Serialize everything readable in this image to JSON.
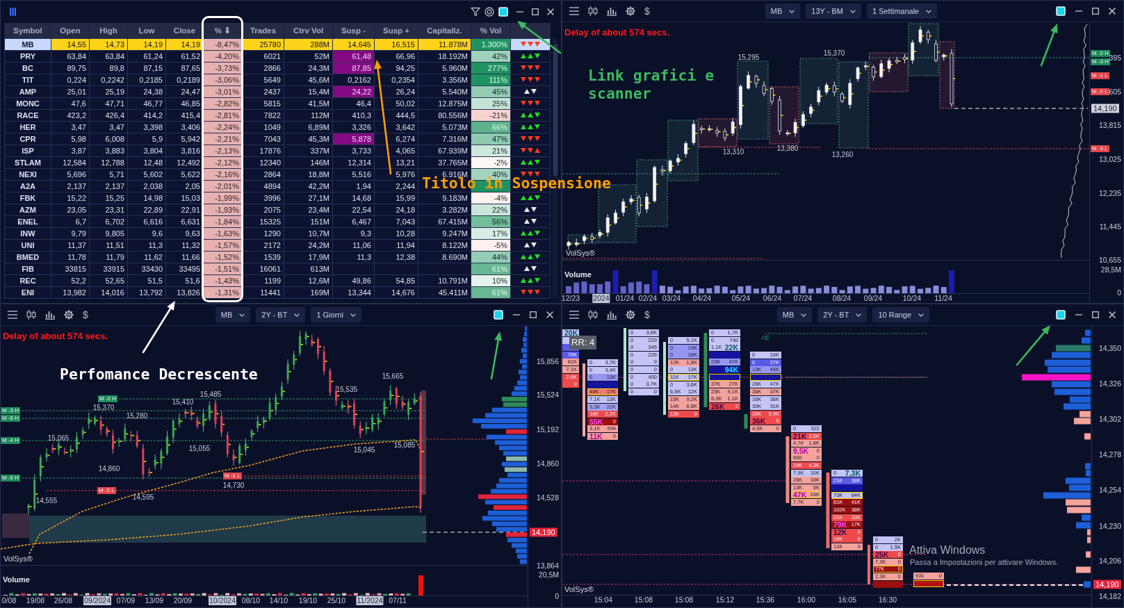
{
  "scanner": {
    "linked": true,
    "columns": [
      "Symbol",
      "Open",
      "High",
      "Low",
      "Close",
      "% ⬇",
      "Trades",
      "Ctrv Vol",
      "Susp -",
      "Susp +",
      "Capitaliz.",
      "% Vol"
    ],
    "rows": [
      {
        "selected": true,
        "cells": [
          "MB",
          "14,55",
          "14,73",
          "14,19",
          "14,19",
          "-8,47%",
          "25780",
          "288M",
          {
            "text": "14,645",
            "flagged": false
          },
          "16,515",
          "11.878M",
          {
            "text": "1.300%",
            "color": "#1f9462"
          }
        ],
        "trend": {
          "color": "#ff3b1a",
          "arrows": [
            {
              "kind": "down"
            },
            {
              "kind": "down"
            },
            {
              "kind": "down"
            }
          ]
        }
      },
      {
        "selected": false,
        "cells": [
          "PRY",
          "63,84",
          "63,84",
          "61,24",
          "61,52",
          "-4,20%",
          "6021",
          "52M",
          {
            "text": "61,48",
            "flagged": true
          },
          "66,96",
          "18.192M",
          {
            "text": "42%",
            "color": "#9ed2bb"
          }
        ],
        "trend": {
          "color": "#1ee01e",
          "arrows": [
            {
              "kind": "up"
            },
            {
              "kind": "up"
            },
            {
              "kind": "down"
            }
          ]
        }
      },
      {
        "selected": false,
        "cells": [
          "BC",
          "89,75",
          "89,8",
          "87,15",
          "87,65",
          "-3,73%",
          "2866",
          "24,3M",
          {
            "text": "87,85",
            "flagged": true
          },
          "94,25",
          "5.960M",
          {
            "text": "277%",
            "color": "#1f9462"
          }
        ],
        "trend": {
          "color": "#ff3b1a",
          "arrows": [
            {
              "kind": "down"
            },
            {
              "kind": "down"
            },
            {
              "kind": "down"
            }
          ]
        }
      },
      {
        "selected": false,
        "cells": [
          "TIT",
          "0,224",
          "0,2242",
          "0,2185",
          "0,2189",
          "-3,06%",
          "5649",
          "45,6M",
          {
            "text": "0,2162",
            "flagged": false
          },
          "0,2354",
          "3.356M",
          {
            "text": "111%",
            "color": "#1f9462"
          }
        ],
        "trend": {
          "color": "#ff3b1a",
          "arrows": [
            {
              "kind": "down"
            },
            {
              "kind": "down"
            },
            {
              "kind": "down"
            }
          ]
        }
      },
      {
        "selected": false,
        "cells": [
          "AMP",
          "25,01",
          "25,19",
          "24,38",
          "24,47",
          "-3,01%",
          "2437",
          "15,4M",
          {
            "text": "24,22",
            "flagged": true
          },
          "26,24",
          "5.540M",
          {
            "text": "45%",
            "color": "#93cdb4"
          }
        ],
        "trend": {
          "color": "#e6e9f2",
          "arrows": [
            {
              "kind": "up"
            },
            {
              "kind": "down"
            }
          ]
        }
      },
      {
        "selected": false,
        "cells": [
          "MONC",
          "47,6",
          "47,71",
          "46,77",
          "46,85",
          "-2,82%",
          "5815",
          "41,5M",
          {
            "text": "46,4",
            "flagged": false
          },
          "50,02",
          "12.875M",
          {
            "text": "25%",
            "color": "#c4e4d5"
          }
        ],
        "trend": {
          "color": "#ff3b1a",
          "arrows": [
            {
              "kind": "down"
            },
            {
              "kind": "down"
            },
            {
              "kind": "down"
            }
          ]
        }
      },
      {
        "selected": false,
        "cells": [
          "RACE",
          "423,2",
          "426,4",
          "414,2",
          "415,4",
          "-2,81%",
          "7822",
          "112M",
          {
            "text": "410,3",
            "flagged": false
          },
          "444,5",
          "80.556M",
          {
            "text": "-21%",
            "color": "#f7d3cf"
          }
        ],
        "trend": {
          "color": "#1ee01e",
          "arrows": [
            {
              "kind": "up"
            },
            {
              "kind": "up"
            },
            {
              "kind": "down"
            }
          ]
        }
      },
      {
        "selected": false,
        "cells": [
          "HER",
          "3,47",
          "3,47",
          "3,398",
          "3,406",
          "-2,24%",
          "1049",
          "6,89M",
          {
            "text": "3,326",
            "flagged": false
          },
          "3,642",
          "5.073M",
          {
            "text": "66%",
            "color": "#5db38c"
          }
        ],
        "trend": {
          "color": "#1ee01e",
          "arrows": [
            {
              "kind": "up"
            },
            {
              "kind": "up"
            },
            {
              "kind": "down"
            }
          ]
        }
      },
      {
        "selected": false,
        "cells": [
          "CPR",
          "5,98",
          "6,008",
          "5,9",
          "5,942",
          "-2,21%",
          "7043",
          "45,3M",
          {
            "text": "5,878",
            "flagged": true
          },
          "6,274",
          "7.316M",
          {
            "text": "47%",
            "color": "#8dcaaf"
          }
        ],
        "trend": {
          "color": "#ff3b1a",
          "arrows": [
            {
              "kind": "down"
            },
            {
              "kind": "down"
            },
            {
              "kind": "down"
            }
          ]
        }
      },
      {
        "selected": false,
        "cells": [
          "ISP",
          "3,87",
          "3,883",
          "3,804",
          "3,816",
          "-2,13%",
          "17876",
          "337M",
          {
            "text": "3,733",
            "flagged": false
          },
          "4,065",
          "67.939M",
          {
            "text": "21%",
            "color": "#cde8db"
          }
        ],
        "trend": {
          "color": "#ff3b1a",
          "arrows": [
            {
              "kind": "down"
            },
            {
              "kind": "down"
            },
            {
              "kind": "up"
            }
          ]
        }
      },
      {
        "selected": false,
        "cells": [
          "STLAM",
          "12,584",
          "12,788",
          "12,48",
          "12,492",
          "-2,12%",
          "12340",
          "146M",
          {
            "text": "12,314",
            "flagged": false
          },
          "13,21",
          "37.765M",
          {
            "text": "-2%",
            "color": "#fdf7f5"
          }
        ],
        "trend": {
          "color": "#1ee01e",
          "arrows": [
            {
              "kind": "up"
            },
            {
              "kind": "up"
            },
            {
              "kind": "down"
            }
          ]
        }
      },
      {
        "selected": false,
        "cells": [
          "NEXI",
          "5,696",
          "5,71",
          "5,602",
          "5,622",
          "-2,16%",
          "2864",
          "18,8M",
          {
            "text": "5,516",
            "flagged": false
          },
          "5,976",
          "6.916M",
          {
            "text": "40%",
            "color": "#a3d4be"
          }
        ],
        "trend": {
          "color": "#ff3b1a",
          "arrows": [
            {
              "kind": "down"
            },
            {
              "kind": "down"
            },
            {
              "kind": "down"
            }
          ]
        }
      },
      {
        "selected": false,
        "cells": [
          "A2A",
          "2,137",
          "2,137",
          "2,038",
          "2,05",
          "-2,01%",
          "4894",
          "42,2M",
          {
            "text": "1,94",
            "flagged": false
          },
          "2,244",
          "",
          {
            "color": "#1f9462"
          }
        ]
      },
      {
        "selected": false,
        "cells": [
          "FBK",
          "15,22",
          "15,25",
          "14,98",
          "15,03",
          "-1,99%",
          "3996",
          "27,1M",
          {
            "text": "14,68",
            "flagged": false
          },
          "15,99",
          "9.183M",
          {
            "text": "-4%",
            "color": "#fdf2ef"
          }
        ],
        "trend": {
          "color": "#1ee01e",
          "arrows": [
            {
              "kind": "up"
            },
            {
              "kind": "up"
            },
            {
              "kind": "down"
            }
          ]
        }
      },
      {
        "selected": false,
        "cells": [
          "AZM",
          "23,05",
          "23,31",
          "22,89",
          "22,91",
          "-1,93%",
          "2075",
          "23,4M",
          {
            "text": "22,54",
            "flagged": false
          },
          "24,18",
          "3.282M",
          {
            "text": "22%",
            "color": "#cae6d9"
          }
        ],
        "trend": {
          "color": "#e6e9f2",
          "arrows": [
            {
              "kind": "up"
            },
            {
              "kind": "down"
            }
          ]
        }
      },
      {
        "selected": false,
        "cells": [
          "ENEL",
          "6,7",
          "6,702",
          "6,616",
          "6,631",
          "-1,84%",
          "15325",
          "151M",
          {
            "text": "6,467",
            "flagged": false
          },
          "7,043",
          "67.415M",
          {
            "text": "56%",
            "color": "#72bd9a"
          }
        ],
        "trend": {
          "color": "#e6e9f2",
          "arrows": [
            {
              "kind": "up"
            },
            {
              "kind": "down"
            }
          ]
        }
      },
      {
        "selected": false,
        "cells": [
          "INW",
          "9,79",
          "9,805",
          "9,6",
          "9,63",
          "-1,63%",
          "1290",
          "10,7M",
          {
            "text": "9,3",
            "flagged": false
          },
          "10,28",
          "9.247M",
          {
            "text": "17%",
            "color": "#d7ede3"
          }
        ],
        "trend": {
          "color": "#1ee01e",
          "arrows": [
            {
              "kind": "up"
            },
            {
              "kind": "up"
            },
            {
              "kind": "down"
            }
          ]
        }
      },
      {
        "selected": false,
        "cells": [
          "UNI",
          "11,37",
          "11,51",
          "11,3",
          "11,32",
          "-1,57%",
          "2172",
          "24,2M",
          {
            "text": "11,06",
            "flagged": false
          },
          "11,94",
          "8.122M",
          {
            "text": "-5%",
            "color": "#fdf0ed"
          }
        ],
        "trend": {
          "color": "#e6e9f2",
          "arrows": [
            {
              "kind": "up"
            },
            {
              "kind": "down"
            }
          ]
        }
      },
      {
        "selected": false,
        "cells": [
          "BMED",
          "11,78",
          "11,79",
          "11,62",
          "11,66",
          "-1,52%",
          "1539",
          "17,9M",
          {
            "text": "11,3",
            "flagged": false
          },
          "12,38",
          "8.690M",
          {
            "text": "44%",
            "color": "#96ceb5"
          }
        ],
        "trend": {
          "color": "#1ee01e",
          "arrows": [
            {
              "kind": "up"
            },
            {
              "kind": "up"
            },
            {
              "kind": "down"
            }
          ]
        }
      },
      {
        "selected": false,
        "cells": [
          "FIB",
          "33815",
          "33915",
          "33430",
          "33495",
          "-1,51%",
          "16061",
          "613M",
          "",
          "",
          "",
          {
            "text": "61%",
            "color": "#67b793"
          }
        ],
        "trend": {
          "color": "#e6e9f2",
          "arrows": [
            {
              "kind": "up"
            },
            {
              "kind": "down"
            }
          ]
        }
      },
      {
        "selected": false,
        "cells": [
          "REC",
          "52,2",
          "52,65",
          "51,5",
          "51,6",
          "-1,43%",
          "1199",
          "12,6M",
          {
            "text": "49,86",
            "flagged": false
          },
          "54,85",
          "10.791M",
          {
            "text": "10%",
            "color": "#e5f3ec"
          }
        ],
        "trend": {
          "color": "#1ee01e",
          "arrows": [
            {
              "kind": "up"
            },
            {
              "kind": "up"
            },
            {
              "kind": "down"
            }
          ]
        }
      },
      {
        "selected": false,
        "cells": [
          "ENI",
          "13,982",
          "14,016",
          "13,792",
          "13,826",
          "-1,31%",
          "11441",
          "169M",
          {
            "text": "13,344",
            "flagged": false
          },
          "14,676",
          "45.411M",
          {
            "text": "61%",
            "color": "#67b793"
          }
        ],
        "trend": {
          "color": "#ff3b1a",
          "arrows": [
            {
              "kind": "down"
            },
            {
              "kind": "down"
            },
            {
              "kind": "down"
            }
          ]
        }
      }
    ]
  },
  "charts": [
    {
      "kind": "box_candles",
      "toolbar": {
        "currency": "$",
        "selectors": [
          "MB",
          "13Y - BM",
          "1 Settimanale"
        ],
        "linked": true
      },
      "delay": "Delay of about 574 secs.",
      "price_labels": [
        "15,295",
        "15,370",
        "13,310",
        "13,380",
        "13,260"
      ],
      "brand": "VolSys®",
      "price_ticks": [
        "395",
        "605",
        "13,815",
        "13,025",
        "12,235",
        "11,445",
        "10,655"
      ],
      "price_tags": [
        {
          "text": "M -2 H",
          "kind": "high"
        },
        {
          "text": "M -3 H",
          "kind": "high"
        },
        {
          "text": "M -1 L",
          "kind": "low"
        },
        {
          "text": "M -2 L",
          "kind": "low"
        },
        {
          "text": "M -3 L",
          "kind": "low"
        }
      ],
      "last_price": {
        "text": "14,190",
        "kind": "neutral"
      },
      "volume": {
        "label": "Volume",
        "ticks": [
          "28,5M",
          "0"
        ]
      },
      "time_ticks": [
        {
          "text": "12/23",
          "highlighted": false
        },
        {
          "text": "2024",
          "highlighted": true
        },
        {
          "text": "01/24",
          "highlighted": false
        },
        {
          "text": "02/24",
          "highlighted": false
        },
        {
          "text": "03/24",
          "highlighted": false
        },
        {
          "text": "04/24",
          "highlighted": false
        },
        {
          "text": "05/24",
          "highlighted": false
        },
        {
          "text": "06/24",
          "highlighted": false
        },
        {
          "text": "07/24",
          "highlighted": false
        },
        {
          "text": "08/24",
          "highlighted": false
        },
        {
          "text": "09/24",
          "highlighted": false
        },
        {
          "text": "10/24",
          "highlighted": false
        },
        {
          "text": "11/24",
          "highlighted": false
        }
      ]
    },
    {
      "kind": "candles",
      "toolbar": {
        "currency": "$",
        "selectors": [
          "MB",
          "2Y - BT",
          "1 Giorni"
        ],
        "linked": true
      },
      "delay": "Delay of about 574 secs.",
      "price_labels": [
        "15,665",
        "15,535",
        "15,485",
        "15,410",
        "15,370",
        "15,280",
        "15,065",
        "15,085",
        "15,055",
        "15,045",
        "14,860",
        "14,730",
        "14,595",
        "14,555"
      ],
      "brand": "VolSys®",
      "price_ticks": [
        "15,856",
        "15,524",
        "15,192",
        "14,860",
        "14,528",
        "13,864"
      ],
      "price_tags": [
        {
          "text": "M -3 H",
          "kind": "high"
        },
        {
          "text": "M -6 H",
          "kind": "high"
        },
        {
          "text": "M -4 H",
          "kind": "high"
        },
        {
          "text": "M -5 H",
          "kind": "high"
        },
        {
          "text": "M -2 H",
          "kind": "high"
        },
        {
          "text": "M -1 L",
          "kind": "low"
        },
        {
          "text": "M -2 L",
          "kind": "low"
        }
      ],
      "last_price": {
        "text": "14,190",
        "kind": "down"
      },
      "volume": {
        "label": "Volume",
        "ticks": [
          "20,5M",
          "0"
        ]
      },
      "time_ticks": [
        {
          "text": "0/08",
          "highlighted": false
        },
        {
          "text": "19/08",
          "highlighted": false
        },
        {
          "text": "26/08",
          "highlighted": false
        },
        {
          "text": "09/2024",
          "highlighted": true
        },
        {
          "text": "07/09",
          "highlighted": false
        },
        {
          "text": "13/09",
          "highlighted": false
        },
        {
          "text": "20/09",
          "highlighted": false
        },
        {
          "text": "10/2024",
          "highlighted": true
        },
        {
          "text": "08/10",
          "highlighted": false
        },
        {
          "text": "14/10",
          "highlighted": false
        },
        {
          "text": "19/10",
          "highlighted": false
        },
        {
          "text": "25/10",
          "highlighted": false
        },
        {
          "text": "11/2024",
          "highlighted": true
        },
        {
          "text": "07/11",
          "highlighted": false
        }
      ]
    },
    {
      "kind": "footprint",
      "toolbar": {
        "currency": "$",
        "selectors": [
          "MB",
          "2Y - BT",
          "10 Range"
        ],
        "linked": true
      },
      "badge": "RR: 4",
      "markers": [
        "AE"
      ],
      "brand": "VolSys®",
      "price_ticks": [
        "14,350",
        "14,326",
        "14,302",
        "14,278",
        "14,254",
        "14,230",
        "14,206",
        "14,182"
      ],
      "last_price": {
        "text": "14,190",
        "kind": "down"
      },
      "time_ticks": [
        {
          "text": "15:04",
          "highlighted": false
        },
        {
          "text": "15:08",
          "highlighted": false
        },
        {
          "text": "15:08",
          "highlighted": false
        },
        {
          "text": "15:12",
          "highlighted": false
        },
        {
          "text": "15:36",
          "highlighted": false
        },
        {
          "text": "16:00",
          "highlighted": false
        },
        {
          "text": "16:05",
          "highlighted": false
        },
        {
          "text": "16:30",
          "highlighted": false
        }
      ],
      "footprint": [
        {
          "cells": [
            {
              "ask": "20K",
              "kind": "ask_imbalance",
              "color": "#c4c4f6",
              "highlight": false
            },
            {
              "kind": "plain",
              "color": "#c4c4f6",
              "highlight": false
            },
            {
              "kind": "plain",
              "color": "#5a5ae6",
              "highlight": false
            },
            {
              "ask": "79K",
              "kind": "plain",
              "color": "#5a5ae6",
              "highlight": false
            },
            {
              "ask": "61K",
              "kind": "plain",
              "color": "#f4a29c",
              "highlight": false
            },
            {
              "ask": "7,1K",
              "kind": "plain",
              "color": "#f4a29c",
              "highlight": false
            },
            {
              "ask": "2,6K",
              "kind": "plain",
              "color": "#ee4a4a",
              "highlight": false
            },
            {
              "ask": "0",
              "kind": "plain",
              "color": "#ee4a4a",
              "highlight": false
            }
          ]
        },
        {
          "cells": [
            {
              "bid": "0",
              "ask": "3,7K",
              "kind": "plain",
              "color": "#c4c4f6",
              "highlight": false
            },
            {
              "bid": "0",
              "ask": "3,4K",
              "kind": "plain",
              "color": "#c4c4f6",
              "highlight": false
            },
            {
              "bid": "0",
              "ask": "13K",
              "kind": "plain",
              "color": "#9696f0",
              "highlight": false
            },
            {
              "kind": "plain",
              "color": "#14149c",
              "highlight": false
            },
            {
              "bid": "40K",
              "ask": "17K",
              "kind": "plain",
              "color": "#f07a6a",
              "highlight": true
            },
            {
              "bid": "7,1K",
              "ask": "13K",
              "kind": "plain",
              "color": "#c4c4f6",
              "highlight": false
            },
            {
              "bid": "9,3K",
              "ask": "22K",
              "kind": "plain",
              "color": "#a4a4f2",
              "highlight": false
            },
            {
              "bid": "16K",
              "ask": "2,2K",
              "kind": "plain",
              "color": "#ee4a4a",
              "highlight": false
            },
            {
              "bid": "55K",
              "ask": "0",
              "kind": "bid_imbalance",
              "color": "#9a0e0e",
              "highlight": false
            },
            {
              "bid": "3,1K",
              "ask": "994",
              "kind": "plain",
              "color": "#f4a29c",
              "highlight": false
            },
            {
              "bid": "11K",
              "ask": "0",
              "kind": "bid_imbalance",
              "color": "#f4a29c",
              "highlight": false
            }
          ]
        },
        {
          "cells": [
            {
              "bid": "0",
              "ask": "3,6K",
              "kind": "plain",
              "color": "#c4c4f6",
              "highlight": false
            },
            {
              "bid": "0",
              "ask": "229",
              "kind": "plain",
              "color": "#c4c4f6",
              "highlight": false
            },
            {
              "bid": "0",
              "ask": "345",
              "kind": "plain",
              "color": "#c4c4f6",
              "highlight": false
            },
            {
              "bid": "0",
              "ask": "226",
              "kind": "plain",
              "color": "#c4c4f6",
              "highlight": false
            },
            {
              "bid": "0",
              "ask": "0",
              "kind": "plain",
              "color": "#c4c4f6",
              "highlight": false
            },
            {
              "bid": "0",
              "ask": "0",
              "kind": "plain",
              "color": "#c4c4f6",
              "highlight": false
            },
            {
              "bid": "0",
              "ask": "400",
              "kind": "plain",
              "color": "#c4c4f6",
              "highlight": false
            },
            {
              "bid": "0",
              "ask": "3,7K",
              "kind": "plain",
              "color": "#c4c4f6",
              "highlight": false
            },
            {
              "bid": "0",
              "ask": "0",
              "kind": "plain",
              "color": "#c4c4f6",
              "highlight": false
            }
          ]
        },
        {
          "cells": [
            {
              "bid": "0",
              "ask": "5,1K",
              "kind": "plain",
              "color": "#c4c4f6",
              "highlight": false
            },
            {
              "bid": "0",
              "ask": "13K",
              "kind": "plain",
              "color": "#9696f0",
              "highlight": false
            },
            {
              "bid": "0",
              "ask": "16K",
              "kind": "plain",
              "color": "#9696f0",
              "highlight": false
            },
            {
              "bid": "12K",
              "ask": "1,8K",
              "kind": "plain",
              "color": "#f4a29c",
              "highlight": false
            },
            {
              "bid": "0",
              "ask": "13K",
              "kind": "plain",
              "color": "#c4c4f6",
              "highlight": false
            },
            {
              "bid": "11K",
              "ask": "17K",
              "kind": "plain",
              "color": "#c4c4f6",
              "highlight": true
            },
            {
              "bid": "0",
              "ask": "3,6K",
              "kind": "plain",
              "color": "#c4c4f6",
              "highlight": false
            },
            {
              "bid": "6,5K",
              "ask": "12K",
              "kind": "plain",
              "color": "#c4c4f6",
              "highlight": false
            },
            {
              "bid": "15K",
              "ask": "9,2K",
              "kind": "plain",
              "color": "#f4a29c",
              "highlight": false
            },
            {
              "bid": "14K",
              "ask": "6,8K",
              "kind": "plain",
              "color": "#f4a29c",
              "highlight": false
            },
            {
              "bid": "13K",
              "ask": "0",
              "kind": "plain",
              "color": "#ee4a4a",
              "highlight": false
            }
          ]
        },
        {
          "cells": [
            {
              "bid": "0",
              "ask": "1,7K",
              "kind": "plain",
              "color": "#c4c4f6",
              "highlight": false
            },
            {
              "bid": "0",
              "ask": "740",
              "kind": "plain",
              "color": "#c4c4f6",
              "highlight": false
            },
            {
              "bid": "1,1K",
              "ask": "22K",
              "kind": "ask_imbalance",
              "color": "#c4c4f6",
              "highlight": false
            },
            {
              "kind": "plain",
              "color": "#14149c",
              "highlight": false
            },
            {
              "bid": "23K",
              "ask": "47K",
              "kind": "plain",
              "color": "#9696f0",
              "highlight": false
            },
            {
              "ask": "94K",
              "kind": "ask_imbalance",
              "color": "#14149c",
              "highlight": false
            },
            {
              "kind": "plain",
              "color": "#14149c",
              "highlight": true
            },
            {
              "bid": "37K",
              "ask": "27K",
              "kind": "plain",
              "color": "#f4a29c",
              "highlight": false
            },
            {
              "bid": "25K",
              "ask": "9,1K",
              "kind": "plain",
              "color": "#f4a29c",
              "highlight": false
            },
            {
              "bid": "6,3K",
              "ask": "1,1K",
              "kind": "plain",
              "color": "#f4a29c",
              "highlight": false
            },
            {
              "bid": "26K",
              "ask": "2",
              "kind": "bid_imbalance",
              "color": "#ee4a4a",
              "highlight": false
            }
          ]
        },
        {
          "cells": [
            {
              "bid": "0",
              "ask": "10K",
              "kind": "plain",
              "color": "#c4c4f6",
              "highlight": false
            },
            {
              "bid": "0",
              "ask": "27K",
              "kind": "plain",
              "color": "#5a5ae6",
              "highlight": false
            },
            {
              "bid": "13K",
              "ask": "44K",
              "kind": "plain",
              "color": "#9696f0",
              "highlight": false
            },
            {
              "kind": "plain",
              "color": "#14149c",
              "highlight": true
            },
            {
              "bid": "26K",
              "ask": "47K",
              "kind": "plain",
              "color": "#c4c4f6",
              "highlight": false
            },
            {
              "bid": "38K",
              "ask": "37K",
              "kind": "plain",
              "color": "#f4a29c",
              "highlight": false
            },
            {
              "bid": "16K",
              "ask": "36K",
              "kind": "plain",
              "color": "#c4c4f6",
              "highlight": false
            },
            {
              "bid": "30K",
              "ask": "31K",
              "kind": "plain",
              "color": "#c4c4f6",
              "highlight": false
            },
            {
              "bid": "20K",
              "ask": "5,9K",
              "kind": "plain",
              "color": "#ee4a4a",
              "highlight": false
            },
            {
              "bid": "36K",
              "ask": "0",
              "kind": "bid_imbalance",
              "color": "#ee4a4a",
              "highlight": false
            },
            {
              "bid": "4,5K",
              "ask": "0",
              "kind": "plain",
              "color": "#f4a29c",
              "highlight": false
            }
          ]
        },
        {
          "cells": [
            {
              "bid": "0",
              "ask": "322",
              "kind": "plain",
              "color": "#c4c4f6",
              "highlight": false
            },
            {
              "bid": "21K",
              "ask": "2,6K",
              "kind": "bid_imbalance",
              "color": "#ee4a4a",
              "highlight": false
            },
            {
              "bid": "4,7K",
              "ask": "1,8K",
              "kind": "plain",
              "color": "#f4a29c",
              "highlight": false
            },
            {
              "bid": "9,5K",
              "ask": "0",
              "kind": "bid_imbalance",
              "color": "#f4a29c",
              "highlight": false
            },
            {
              "bid": "600",
              "ask": "0",
              "kind": "plain",
              "color": "#f4a29c",
              "highlight": false
            },
            {
              "bid": "24K",
              "ask": "6,3K",
              "kind": "plain",
              "color": "#ee4a4a",
              "highlight": false
            },
            {
              "bid": "7,9K",
              "ask": "10K",
              "kind": "plain",
              "color": "#c4c4f6",
              "highlight": false
            },
            {
              "bid": "26K",
              "ask": "18K",
              "kind": "plain",
              "color": "#f4a29c",
              "highlight": false
            },
            {
              "bid": "13K",
              "ask": "5K",
              "kind": "plain",
              "color": "#f4a29c",
              "highlight": false
            },
            {
              "bid": "47K",
              "ask": "24K",
              "kind": "bid_imbalance",
              "color": "#f4a29c",
              "highlight": true
            },
            {
              "bid": "7,7K",
              "ask": "0",
              "kind": "plain",
              "color": "#f4a29c",
              "highlight": false
            }
          ]
        },
        {
          "cells": [
            {
              "bid": "0",
              "ask": "7,3K",
              "kind": "ask_imbalance",
              "color": "#c4c4f6",
              "highlight": false
            },
            {
              "bid": "234",
              "ask": "38K",
              "kind": "plain",
              "color": "#5a5ae6",
              "highlight": false
            },
            {
              "kind": "plain",
              "color": "#14149c",
              "highlight": false
            },
            {
              "bid": "73K",
              "ask": "84K",
              "kind": "plain",
              "color": "#c4c4f6",
              "highlight": true
            },
            {
              "bid": "81K",
              "ask": "41K",
              "kind": "plain",
              "color": "#9a0e0e",
              "highlight": false
            },
            {
              "bid": "102K",
              "ask": "38K",
              "kind": "plain",
              "color": "#9a0e0e",
              "highlight": false
            },
            {
              "bid": "31K",
              "ask": "10K",
              "kind": "plain",
              "color": "#ee4a4a",
              "highlight": false
            },
            {
              "bid": "79K",
              "ask": "17K",
              "kind": "bid_imbalance",
              "color": "#9a0e0e",
              "highlight": false
            },
            {
              "bid": "12K",
              "ask": "0",
              "kind": "bid_imbalance",
              "color": "#ee4a4a",
              "highlight": false
            },
            {
              "bid": "16K",
              "ask": "0",
              "kind": "plain",
              "color": "#ee4a4a",
              "highlight": false
            },
            {
              "bid": "128",
              "ask": "0",
              "kind": "plain",
              "color": "#f4a29c",
              "highlight": false
            }
          ]
        },
        {
          "cells": [
            {
              "bid": "0",
              "ask": "2K",
              "kind": "plain",
              "color": "#c4c4f6",
              "highlight": false
            },
            {
              "bid": "0",
              "ask": "1,5K",
              "kind": "plain",
              "color": "#c4c4f6",
              "highlight": false
            },
            {
              "bid": "25K",
              "ask": "0",
              "kind": "bid_imbalance",
              "color": "#ee4a4a",
              "highlight": false
            },
            {
              "bid": "7,3K",
              "ask": "0",
              "kind": "plain",
              "color": "#f4a29c",
              "highlight": false
            },
            {
              "bid": "77K",
              "ask": "0",
              "kind": "plain",
              "color": "#9a0e0e",
              "highlight": true
            },
            {
              "bid": "2,3K",
              "ask": "0",
              "kind": "plain",
              "color": "#f4a29c",
              "highlight": false
            },
            {
              "kind": "plain",
              "color": "#9a0e0e",
              "highlight": false
            }
          ]
        },
        {
          "cells": [
            {
              "bid": "931",
              "ask": "0",
              "kind": "plain",
              "color": "#f4a29c",
              "highlight": false
            },
            {
              "kind": "plain",
              "color": "#b01414",
              "highlight": true
            }
          ]
        }
      ]
    }
  ],
  "annotations": [
    {
      "text": "Link grafici e scanner",
      "color": "#3dba5e"
    },
    {
      "text": "Titolo in Sospensione",
      "color": "#ffa000"
    },
    {
      "text": "Perfomance Decrescente",
      "color": "#ffffff"
    }
  ],
  "os_notice": {
    "title": "Attiva Windows",
    "text": "Passa a Impostazioni per attivare Windows."
  }
}
